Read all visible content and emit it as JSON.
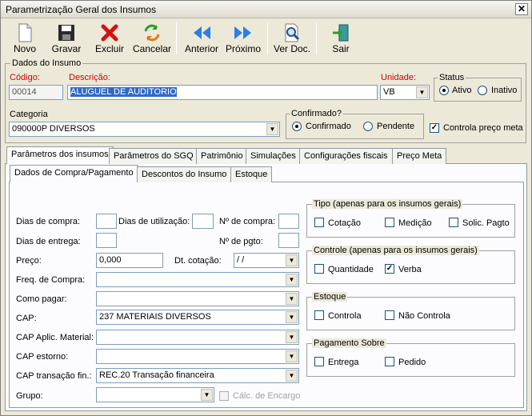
{
  "window": {
    "title": "Parametrização Geral dos Insumos",
    "close": "✕"
  },
  "toolbar": {
    "novo": "Novo",
    "gravar": "Gravar",
    "excluir": "Excluir",
    "cancelar": "Cancelar",
    "anterior": "Anterior",
    "proximo": "Próximo",
    "ver_doc": "Ver Doc.",
    "sair": "Sair"
  },
  "dados": {
    "legend": "Dados do Insumo",
    "codigo_label": "Código:",
    "codigo_value": "00014",
    "descricao_label": "Descrição:",
    "descricao_value": "ALUGUEL DE AUDITORIO",
    "unidade_label": "Unidade:",
    "unidade_value": "VB",
    "categoria_label": "Categoria",
    "categoria_value": "090000P DIVERSOS"
  },
  "status": {
    "legend": "Status",
    "ativo": "Ativo",
    "inativo": "Inativo",
    "selected": "Ativo"
  },
  "confirmado": {
    "legend": "Confirmado?",
    "confirmado": "Confirmado",
    "pendente": "Pendente",
    "selected": "Confirmado"
  },
  "controla_preco_meta": {
    "label": "Controla preço meta",
    "checked": true
  },
  "tabs": [
    "Parâmetros dos insumos",
    "Parâmetros do SGQ",
    "Patrimônio",
    "Simulações",
    "Configurações fiscais",
    "Preço Meta"
  ],
  "subtabs": [
    "Dados de Compra/Pagamento",
    "Descontos do Insumo",
    "Estoque"
  ],
  "form": {
    "dias_compra": "Dias de compra:",
    "dias_utilizacao": "Dias de utilização:",
    "n_compra": "Nº de compra:",
    "dias_entrega": "Dias de entrega:",
    "n_pgto": "Nº de pgto:",
    "preco": "Preço:",
    "preco_value": "0,000",
    "dt_cotacao": "Dt. cotação:",
    "dt_cotacao_value": " /  /",
    "freq_compra": "Freq. de Compra:",
    "como_pagar": "Como pagar:",
    "cap": "CAP:",
    "cap_value": "237 MATERIAIS DIVERSOS",
    "cap_aplic": "CAP Aplic. Material:",
    "cap_estorno": "CAP estorno:",
    "cap_transacao": "CAP transação fin.:",
    "cap_transacao_value": "REC.20 Transação financeira",
    "grupo": "Grupo:",
    "calc_encargo": "Cálc. de Encargo"
  },
  "tipo": {
    "legend": "Tipo (apenas para os insumos gerais)",
    "cotacao": "Cotação",
    "medicao": "Medição",
    "solic_pagto": "Solic. Pagto"
  },
  "controle": {
    "legend": "Controle (apenas para os insumos gerais)",
    "quantidade": "Quantidade",
    "verba": "Verba",
    "verba_checked": true
  },
  "estoque": {
    "legend": "Estoque",
    "controla": "Controla",
    "nao_controla": "Não Controla"
  },
  "pagamento": {
    "legend": "Pagamento Sobre",
    "entrega": "Entrega",
    "pedido": "Pedido"
  },
  "colors": {
    "accent": "#316ac5",
    "required": "#d00000"
  }
}
